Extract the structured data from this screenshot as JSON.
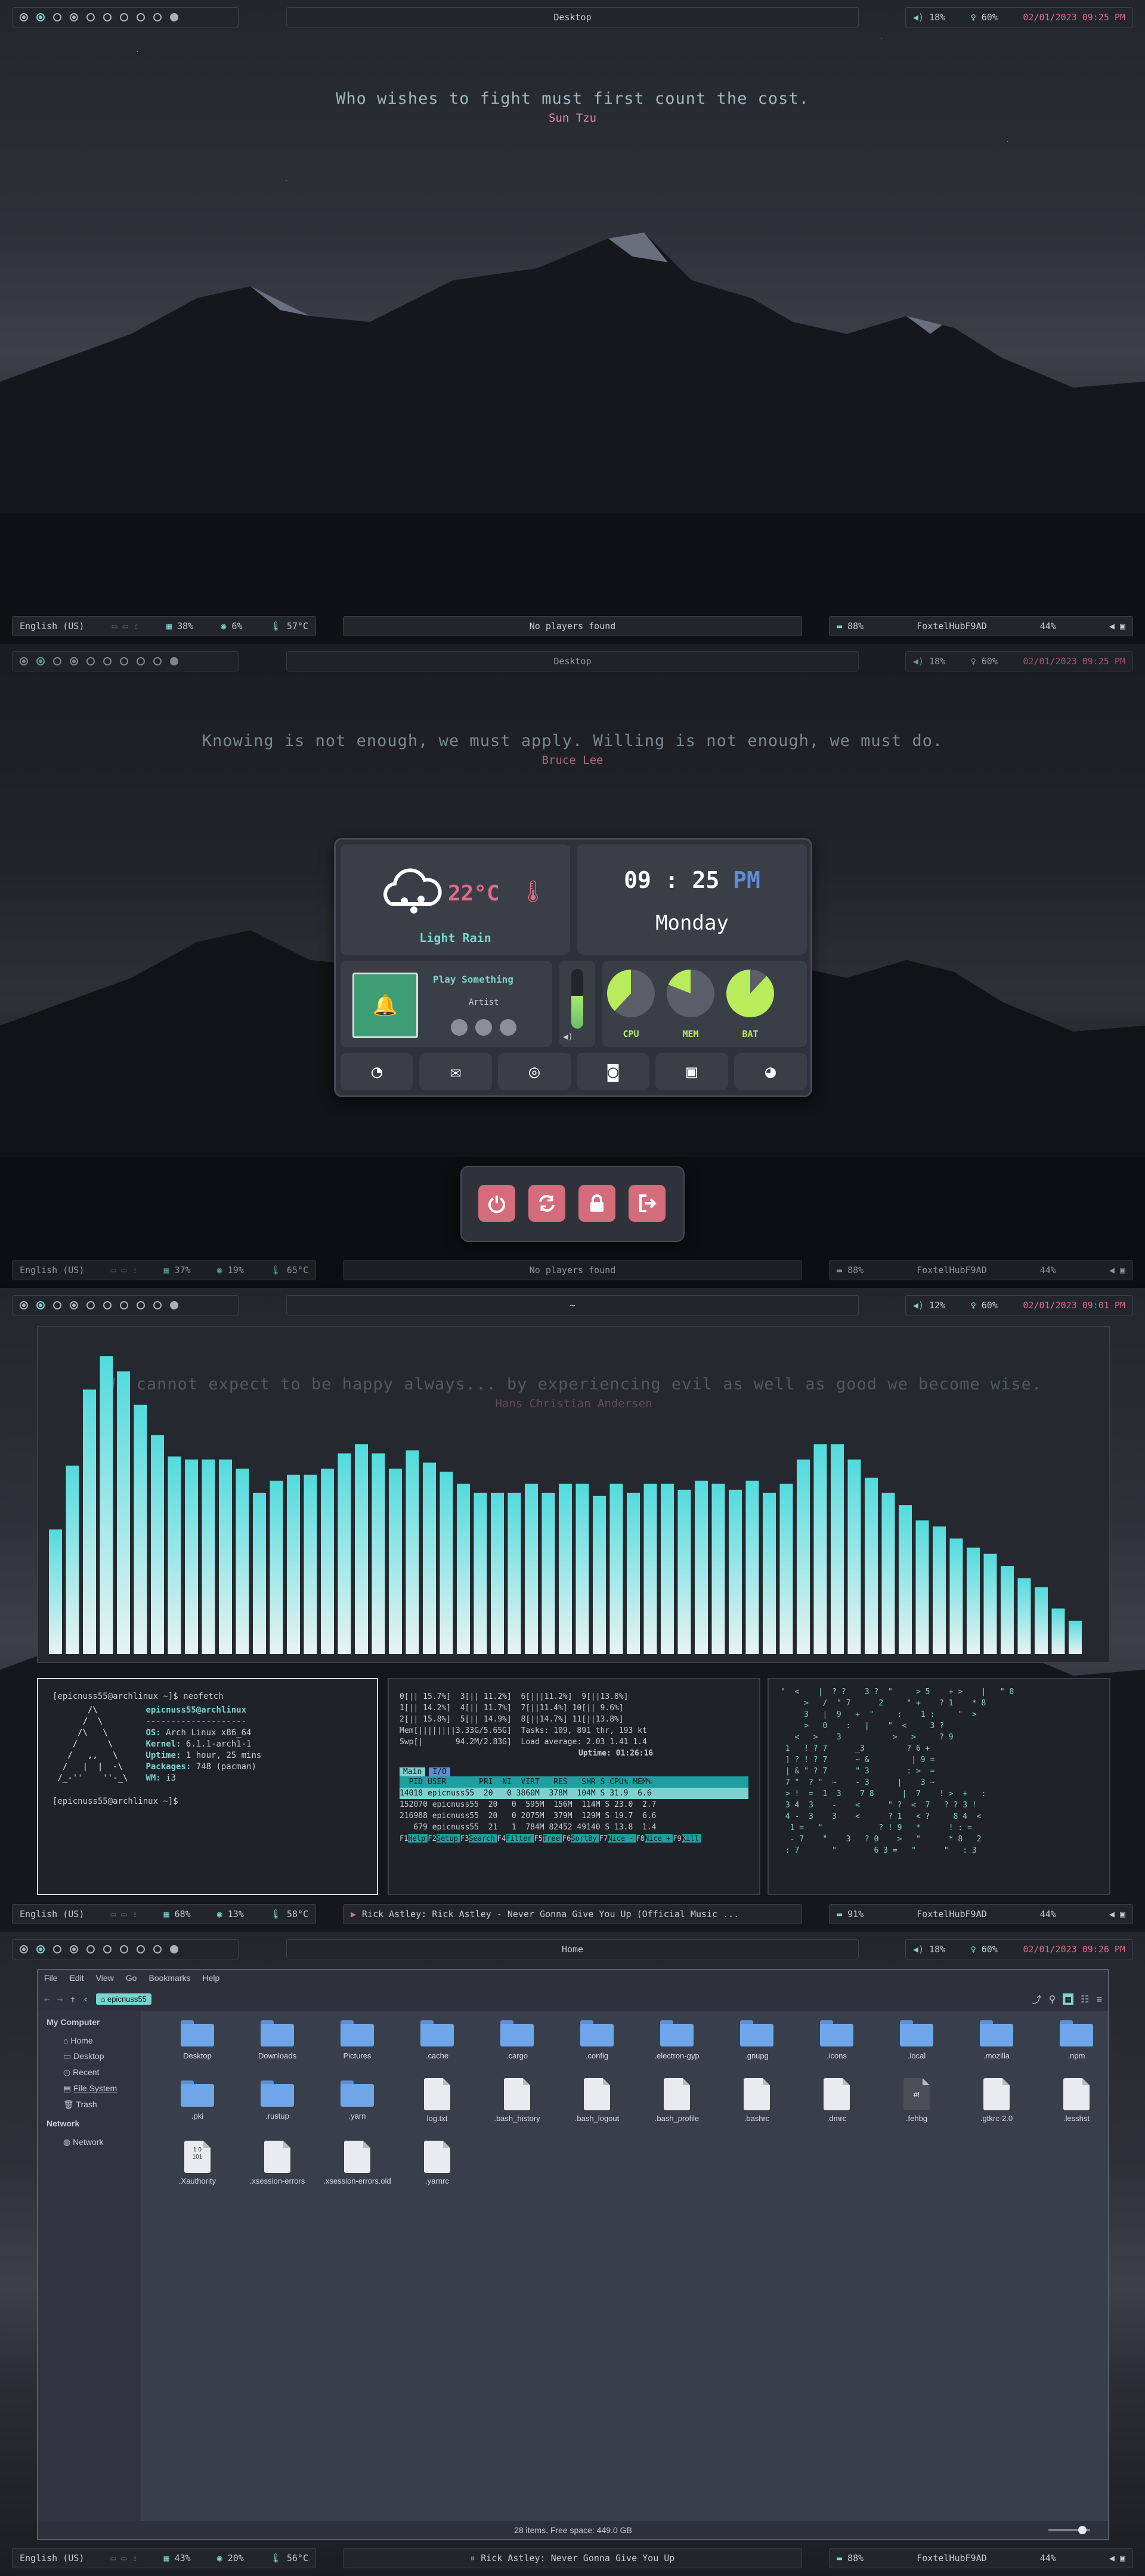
{
  "colors": {
    "accent": "#7ad3d0",
    "pink": "#e06c8a",
    "bar_top": "#52dbdd",
    "bar_bottom": "#e8f3f2"
  },
  "top_bars": [
    {
      "title": "Desktop",
      "volume": "18%",
      "brightness": "60%",
      "datetime": "02/01/2023 09:25 PM"
    },
    {
      "title": "Desktop",
      "volume": "18%",
      "brightness": "60%",
      "datetime": "02/01/2023 09:25 PM"
    },
    {
      "title": "~",
      "volume": "12%",
      "brightness": "60%",
      "datetime": "02/01/2023 09:01 PM"
    },
    {
      "title": "Home",
      "volume": "18%",
      "brightness": "60%",
      "datetime": "02/01/2023 09:26 PM"
    }
  ],
  "bottom_bars": [
    {
      "lang": "English (US)",
      "cpu": "38%",
      "mem": "6%",
      "temp": "57°C",
      "media": "No players found",
      "battery": "88%",
      "host": "FoxtelHubF9AD",
      "wifi": "44%"
    },
    {
      "lang": "English (US)",
      "cpu": "37%",
      "mem": "19%",
      "temp": "65°C",
      "media": "No players found",
      "battery": "88%",
      "host": "FoxtelHubF9AD",
      "wifi": "44%"
    },
    {
      "lang": "English (US)",
      "cpu": "68%",
      "mem": "13%",
      "temp": "58°C",
      "media": "Rick Astley: Rick Astley - Never Gonna Give You Up (Official Music ...",
      "battery": "91%",
      "host": "FoxtelHubF9AD",
      "wifi": "44%"
    },
    {
      "lang": "English (US)",
      "cpu": "43%",
      "mem": "20%",
      "temp": "56°C",
      "media": "Rick Astley: Never Gonna Give You Up",
      "battery": "88%",
      "host": "FoxtelHubF9AD",
      "wifi": "44%"
    }
  ],
  "quotes": [
    {
      "text": "Who wishes to fight must first count the cost.",
      "author": "Sun Tzu"
    },
    {
      "text": "Knowing is not enough, we must apply. Willing is not enough, we must do.",
      "author": "Bruce Lee"
    },
    {
      "text": "We cannot expect to be happy always... by experiencing evil as well as good we become wise.",
      "author": "Hans Christian Andersen"
    }
  ],
  "dashboard": {
    "temp": "22°C",
    "condition": "Light Rain",
    "hour": "09",
    "minute": "25",
    "ampm": "PM",
    "day": "Monday",
    "player_title": "Play Something",
    "player_artist": "Artist",
    "cpu_label": "CPU",
    "mem_label": "MEM",
    "bat_label": "BAT",
    "volume_level": 0.55,
    "cpu_level": 0.38,
    "mem_level": 0.19,
    "bat_level": 0.88,
    "apps": [
      "firefox-icon",
      "mail-icon",
      "spotify-icon",
      "discord-icon",
      "terminal-icon",
      "reddit-icon"
    ]
  },
  "power_menu": [
    "power-icon",
    "reboot-icon",
    "lock-icon",
    "logout-icon"
  ],
  "visualizer": {
    "levels": [
      0.41,
      0.62,
      0.87,
      0.98,
      0.93,
      0.82,
      0.72,
      0.65,
      0.64,
      0.64,
      0.64,
      0.61,
      0.53,
      0.57,
      0.59,
      0.59,
      0.61,
      0.66,
      0.69,
      0.66,
      0.61,
      0.67,
      0.63,
      0.6,
      0.56,
      0.53,
      0.53,
      0.53,
      0.56,
      0.53,
      0.56,
      0.56,
      0.52,
      0.56,
      0.53,
      0.56,
      0.56,
      0.54,
      0.57,
      0.56,
      0.54,
      0.57,
      0.53,
      0.56,
      0.64,
      0.69,
      0.69,
      0.64,
      0.58,
      0.53,
      0.49,
      0.44,
      0.42,
      0.38,
      0.35,
      0.33,
      0.29,
      0.25,
      0.22,
      0.15,
      0.11
    ]
  },
  "neofetch": {
    "prompt": "[epicnuss55@archlinux ~]$ neofetch",
    "userhost": "epicnuss55@archlinux",
    "sep": "--------------------",
    "rows": [
      [
        "OS:",
        "Arch Linux x86_64"
      ],
      [
        "Kernel:",
        "6.1.1-arch1-1"
      ],
      [
        "Uptime:",
        "1 hour, 25 mins"
      ],
      [
        "Packages:",
        "748 (pacman)"
      ],
      [
        "WM:",
        "i3"
      ]
    ],
    "prompt2": "[epicnuss55@archlinux ~]$"
  },
  "htop": {
    "cpus": [
      "0[|| 15.7%]  3[|| 11.2%]  6[|||11.2%]  9[||13.8%]",
      "1[|| 14.2%]  4[|| 11.7%]  7[||11.4%] 10[|| 9.6%]",
      "2[|| 15.8%]  5[|| 14.9%]  8[||14.7%] 11[||13.8%]"
    ],
    "mem": "Mem[||||||||3.33G/5.65G]  Tasks: 109, 891 thr, 193 kt",
    "swp": "Swp[|       94.2M/2.83G]  Load average: 2.03 1.41 1.4",
    "uptime": "Uptime: 01:26:16",
    "tabs": [
      "Main",
      "I/O"
    ],
    "header": "  PID USER       PRI  NI  VIRT   RES   SHR S CPU% MEM%",
    "rows": [
      "14018 epicnuss55  20   0 3860M  378M  104M S 31.9  6.6",
      "152070 epicnuss55  20   0  595M  156M  114M S 23.0  2.7",
      "216988 epicnuss55  20   0 2075M  379M  129M S 19.7  6.6",
      "   679 epicnuss55  21   1  784M 82452 49140 S 13.8  1.4"
    ],
    "fkeys": [
      "Help",
      "Setup",
      "Search",
      "Filter",
      "Tree",
      "SortBy",
      "Nice -",
      "Nice +",
      "Kill"
    ]
  },
  "file_manager": {
    "menu": [
      "File",
      "Edit",
      "View",
      "Go",
      "Bookmarks",
      "Help"
    ],
    "location": "epicnuss55",
    "sidebar": {
      "section1": "My Computer",
      "places": [
        "Home",
        "Desktop",
        "Recent",
        "File System",
        "Trash"
      ],
      "section2": "Network",
      "network": [
        "Network"
      ]
    },
    "items": [
      {
        "name": "Desktop",
        "kind": "folder"
      },
      {
        "name": "Downloads",
        "kind": "folder"
      },
      {
        "name": "Pictures",
        "kind": "folder"
      },
      {
        "name": ".cache",
        "kind": "folder"
      },
      {
        "name": ".cargo",
        "kind": "folder"
      },
      {
        "name": ".config",
        "kind": "folder"
      },
      {
        "name": ".electron-gyp",
        "kind": "folder"
      },
      {
        "name": ".gnupg",
        "kind": "folder"
      },
      {
        "name": ".icons",
        "kind": "folder"
      },
      {
        "name": ".local",
        "kind": "folder"
      },
      {
        "name": ".mozilla",
        "kind": "folder"
      },
      {
        "name": ".npm",
        "kind": "folder"
      },
      {
        "name": ".pki",
        "kind": "folder"
      },
      {
        "name": ".rustup",
        "kind": "folder"
      },
      {
        "name": ".yarn",
        "kind": "folder"
      },
      {
        "name": "log.txt",
        "kind": "file"
      },
      {
        "name": ".bash_history",
        "kind": "file"
      },
      {
        "name": ".bash_logout",
        "kind": "file"
      },
      {
        "name": ".bash_profile",
        "kind": "file"
      },
      {
        "name": ".bashrc",
        "kind": "file"
      },
      {
        "name": ".dmrc",
        "kind": "file"
      },
      {
        "name": ".fehbg",
        "kind": "script"
      },
      {
        "name": ".gtkrc-2.0",
        "kind": "file"
      },
      {
        "name": ".lesshst",
        "kind": "file"
      },
      {
        "name": ".Xauthority",
        "kind": "binary"
      },
      {
        "name": ".xsession-errors",
        "kind": "file"
      },
      {
        "name": ".xsession-errors.old",
        "kind": "file"
      },
      {
        "name": ".yarnrc",
        "kind": "file"
      }
    ],
    "status": "28 items, Free space: 449.0 GB"
  }
}
